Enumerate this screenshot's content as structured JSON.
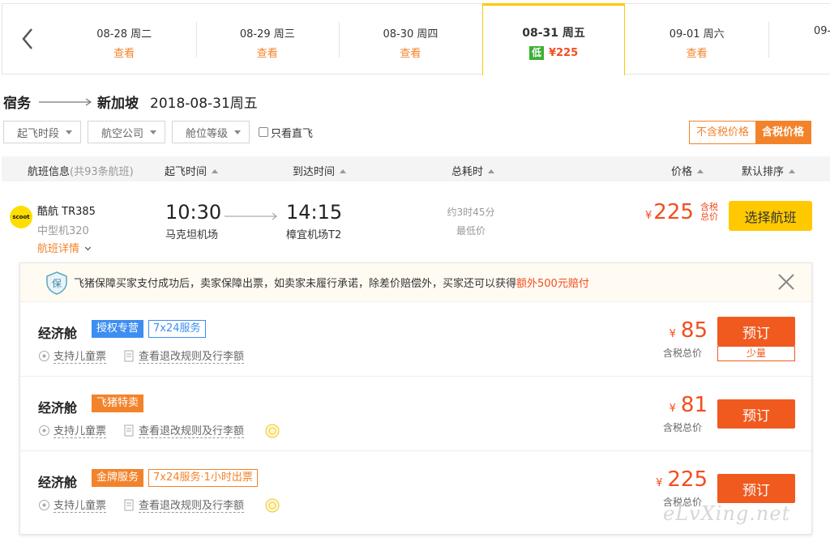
{
  "date_tabs": [
    {
      "date": "08-28 周二",
      "link": "查看"
    },
    {
      "date": "08-29 周三",
      "link": "查看"
    },
    {
      "date": "08-30 周四",
      "link": "查看"
    },
    {
      "date": "08-31 周五",
      "badge": "低",
      "price": "¥225",
      "active": true
    },
    {
      "date": "09-01 周六",
      "link": "查看"
    },
    {
      "date": "09-"
    }
  ],
  "route": {
    "from": "宿务",
    "to": "新加坡",
    "date": "2018-08-31周五"
  },
  "filters": {
    "depart_time": "起飞时段",
    "airline": "航空公司",
    "cabin": "舱位等级",
    "direct_only": "只看直飞"
  },
  "price_toggle": {
    "excl_tax": "不含税价格",
    "incl_tax": "含税价格"
  },
  "list_header": {
    "info": "航班信息",
    "count": "(共93条航班)",
    "depart": "起飞时间",
    "arrive": "到达时间",
    "duration": "总耗时",
    "price": "价格",
    "sort": "默认排序"
  },
  "flight": {
    "logo_text": "scoot",
    "airline": "酷航 TR385",
    "plane": "中型机320",
    "detail_link": "航班详情",
    "depart_time": "10:30",
    "depart_airport": "马克坦机场",
    "arrive_time": "14:15",
    "arrive_airport": "樟宜机场T2",
    "duration": "约3时45分",
    "lowest": "最低价",
    "currency": "¥",
    "price": "225",
    "tax_label": "含税总价",
    "select_button": "选择航班"
  },
  "guarantee": {
    "text": "飞猪保障买家支付成功后，卖家保障出票，如卖家未履行承诺，除差价赔偿外，买家还可以获得",
    "highlight": "额外500元赔付"
  },
  "cabins": [
    {
      "name": "经济舱",
      "tag1": "授权专营",
      "tag2": "7x24服务",
      "child": "支持儿童票",
      "rules": "查看退改规则及行李额",
      "currency": "¥",
      "price": "85",
      "tax_label": "含税总价",
      "book": "预订",
      "note": "少量"
    },
    {
      "name": "经济舱",
      "tag1": "飞猪特卖",
      "child": "支持儿童票",
      "rules": "查看退改规则及行李额",
      "currency": "¥",
      "price": "81",
      "tax_label": "含税总价",
      "book": "预订"
    },
    {
      "name": "经济舱",
      "tag1": "金牌服务",
      "tag2": "7x24服务·1小时出票",
      "child": "支持儿童票",
      "rules": "查看退改规则及行李额",
      "currency": "¥",
      "price": "225",
      "tax_label": "含税总价",
      "book": "预订"
    }
  ],
  "watermark": "eLvXing.net",
  "colors": {
    "accent": "#ffc900",
    "orange": "#f3832b",
    "price_red": "#f24d1f",
    "book_btn": "#f05a1f",
    "tag_blue": "#3d8ef0",
    "low_green": "#3cb034"
  }
}
